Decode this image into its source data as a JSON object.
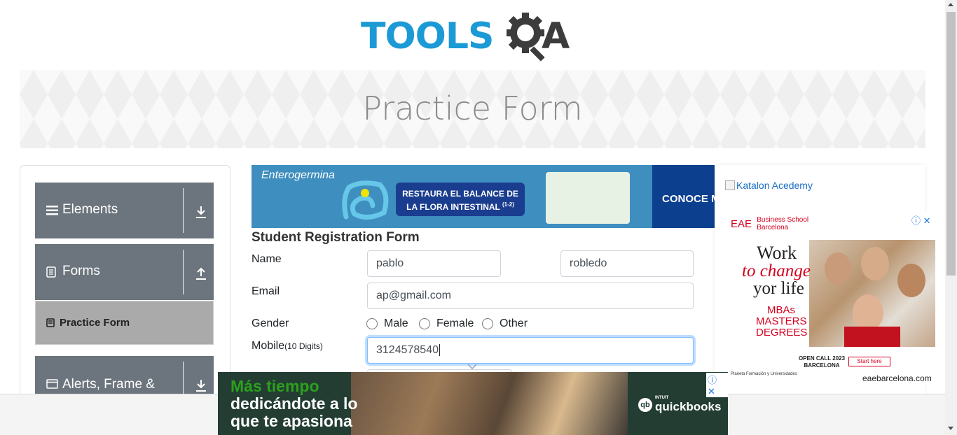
{
  "header": {
    "logo_text": "TOOLS",
    "logo_text_2": "A",
    "brand_colors": {
      "blue": "#1c9ad6",
      "dark": "#3c3c3c"
    }
  },
  "banner": {
    "title": "Practice Form"
  },
  "sidebar": {
    "groups": [
      {
        "label": "Elements",
        "icon": "hamburger-icon",
        "arrow": "download-arrow-icon"
      },
      {
        "label": "Forms",
        "icon": "document-icon",
        "arrow": "upload-arrow-icon"
      },
      {
        "label": "Alerts, Frame &",
        "icon": "window-icon",
        "arrow": "download-arrow-icon"
      }
    ],
    "active_item": {
      "label": "Practice Form",
      "icon": "form-icon"
    }
  },
  "top_ad": {
    "brand": "Enterogermina",
    "headline": "RESTAURA EL BALANCE DE LA FLORA INTESTINAL",
    "footnote": "(1-2)",
    "cta": "CONOCE M"
  },
  "form": {
    "title": "Student Registration Form",
    "name_label": "Name",
    "first_name": "pablo",
    "last_name": "robledo",
    "email_label": "Email",
    "email": "ap@gmail.com",
    "gender_label": "Gender",
    "gender_options": [
      "Male",
      "Female",
      "Other"
    ],
    "mobile_label": "Mobile",
    "mobile_hint": "(10 Digits)",
    "mobile": "3124578540"
  },
  "right_ads": {
    "katalon_alt": "Katalon Acedemy",
    "eae": {
      "logo": "EAE",
      "logo_sub": "Business School Barcelona",
      "line1": "Work",
      "line2": "to change",
      "line3": "yor life",
      "programs": "MBAs MASTERS DEGREES",
      "open_call": "OPEN CALL 2023 BARCELONA",
      "start": "Start here",
      "footer_left": "Planeta Formación y Universidades",
      "url": "eaebarcelona.com",
      "close": "ⓘ ✕"
    }
  },
  "bottom_ad": {
    "line1": "Más tiempo",
    "line2": "dedicándote a lo",
    "line3": "que te apasiona",
    "brand": "quickbooks",
    "brand_sub": "INTUIT",
    "close": "ⓘ ✕"
  }
}
